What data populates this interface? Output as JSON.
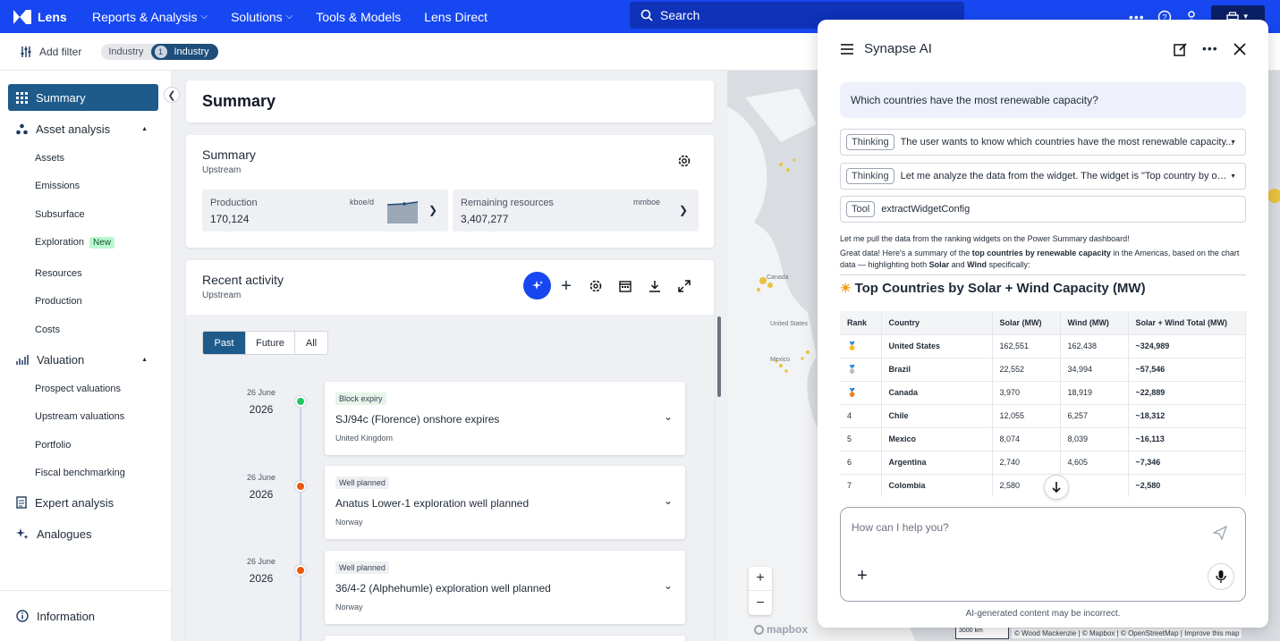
{
  "topbar": {
    "logo": "Lens",
    "nav": [
      "Reports & Analysis",
      "Solutions",
      "Tools & Models",
      "Lens Direct"
    ],
    "search_placeholder": "Search"
  },
  "filters": {
    "add_label": "Add filter",
    "chip_label": "Industry",
    "chip_count": "1",
    "chip_value": "Industry"
  },
  "sidebar": {
    "summary": "Summary",
    "asset_analysis": "Asset analysis",
    "asset_items": [
      "Assets",
      "Emissions",
      "Subsurface",
      "Exploration",
      "Resources",
      "Production",
      "Costs"
    ],
    "new_badge": "New",
    "valuation": "Valuation",
    "valuation_items": [
      "Prospect valuations",
      "Upstream valuations",
      "Portfolio",
      "Fiscal benchmarking"
    ],
    "expert": "Expert analysis",
    "analogues": "Analogues",
    "information": "Information"
  },
  "main": {
    "page_title": "Summary",
    "summary_card": {
      "title": "Summary",
      "subtitle": "Upstream",
      "production": {
        "label": "Production",
        "unit": "kboe/d",
        "value": "170,124"
      },
      "remaining": {
        "label": "Remaining resources",
        "unit": "mmboe",
        "value": "3,407,277"
      }
    },
    "activity": {
      "title": "Recent activity",
      "subtitle": "Upstream",
      "tabs": [
        "Past",
        "Future",
        "All"
      ],
      "items": [
        {
          "day": "26 June",
          "year": "2026",
          "tag": "Block expiry",
          "title": "SJ/94c (Florence) onshore expires",
          "country": "United Kingdom",
          "dot": "#22c55e"
        },
        {
          "day": "26 June",
          "year": "2026",
          "tag": "Well planned",
          "title": "Anatus Lower-1 exploration well planned",
          "country": "Norway",
          "dot": "#ea580c"
        },
        {
          "day": "26 June",
          "year": "2026",
          "tag": "Well planned",
          "title": "36/4-2 (Alphehumle) exploration well planned",
          "country": "Norway",
          "dot": "#ea580c"
        }
      ]
    }
  },
  "map": {
    "labels": [
      "Canada",
      "United States",
      "Mexico"
    ],
    "attribution": "© Wood Mackenzie | © Mapbox | © OpenStreetMap | Improve this map",
    "scale": "3000 km",
    "mapbox": "mapbox"
  },
  "assistant": {
    "title": "Synapse AI",
    "user_question": "Which countries have the most renewable capacity?",
    "steps": [
      {
        "tag": "Thinking",
        "text": "The user wants to know which countries have the most renewable capacity..."
      },
      {
        "tag": "Thinking",
        "text": "Let me analyze the data from the widget. The widget is \"Top country by ope..."
      },
      {
        "tag": "Tool",
        "text": "extractWidgetConfig"
      }
    ],
    "msg1": "Let me pull the data from the ranking widgets on the Power Summary dashboard!",
    "msg2_a": "Great data! Here's a summary of the ",
    "msg2_b": "top countries by renewable capacity",
    "msg2_c": " in the Americas, based on the chart data — highlighting both ",
    "msg2_d": "Solar",
    "msg2_e": " and ",
    "msg2_f": "Wind",
    "msg2_g": " specifically:",
    "heading": "Top Countries by Solar + Wind Capacity (MW)",
    "table": {
      "headers": [
        "Rank",
        "Country",
        "Solar (MW)",
        "Wind (MW)",
        "Solar + Wind Total (MW)"
      ],
      "rows": [
        [
          "🥇",
          "United States",
          "162,551",
          "162,438",
          "~324,989"
        ],
        [
          "🥈",
          "Brazil",
          "22,552",
          "34,994",
          "~57,546"
        ],
        [
          "🥉",
          "Canada",
          "3,970",
          "18,919",
          "~22,889"
        ],
        [
          "4",
          "Chile",
          "12,055",
          "6,257",
          "~18,312"
        ],
        [
          "5",
          "Mexico",
          "8,074",
          "8,039",
          "~16,113"
        ],
        [
          "6",
          "Argentina",
          "2,740",
          "4,605",
          "~7,346"
        ],
        [
          "7",
          "Colombia",
          "2,580",
          "",
          "~2,580"
        ]
      ]
    },
    "input_placeholder": "How can I help you?",
    "disclaimer": "AI-generated content may be incorrect."
  }
}
